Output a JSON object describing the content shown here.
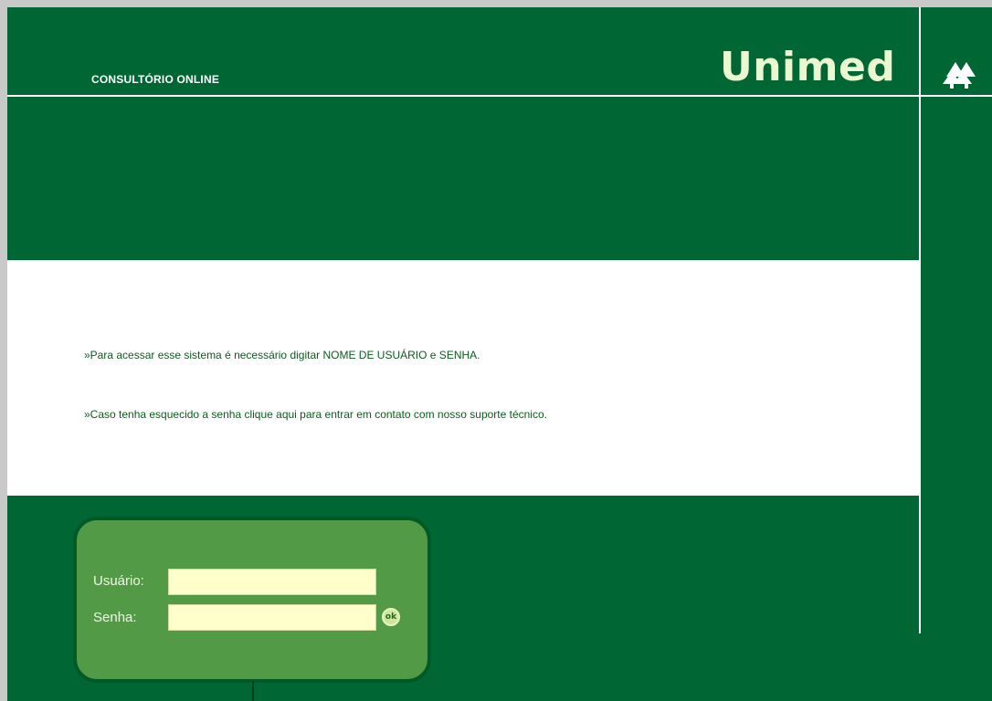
{
  "header": {
    "app_title": "CONSULTÓRIO ONLINE",
    "brand_name": "Unimed",
    "logo_icon": "unimed-tree-icon"
  },
  "info": {
    "line1": "»Para acessar esse sistema é necessário digitar NOME DE USUÁRIO e SENHA.",
    "line2": "»Caso tenha esquecido a senha clique aqui para entrar em contato com nosso suporte técnico."
  },
  "login": {
    "user_label": "Usuário:",
    "user_value": "",
    "pass_label": "Senha:",
    "pass_value": "",
    "ok_label": "ok"
  },
  "colors": {
    "brand_green": "#006633",
    "login_box": "#529a45",
    "input_bg": "#ffffcc",
    "text_green": "#0d5a1f"
  }
}
